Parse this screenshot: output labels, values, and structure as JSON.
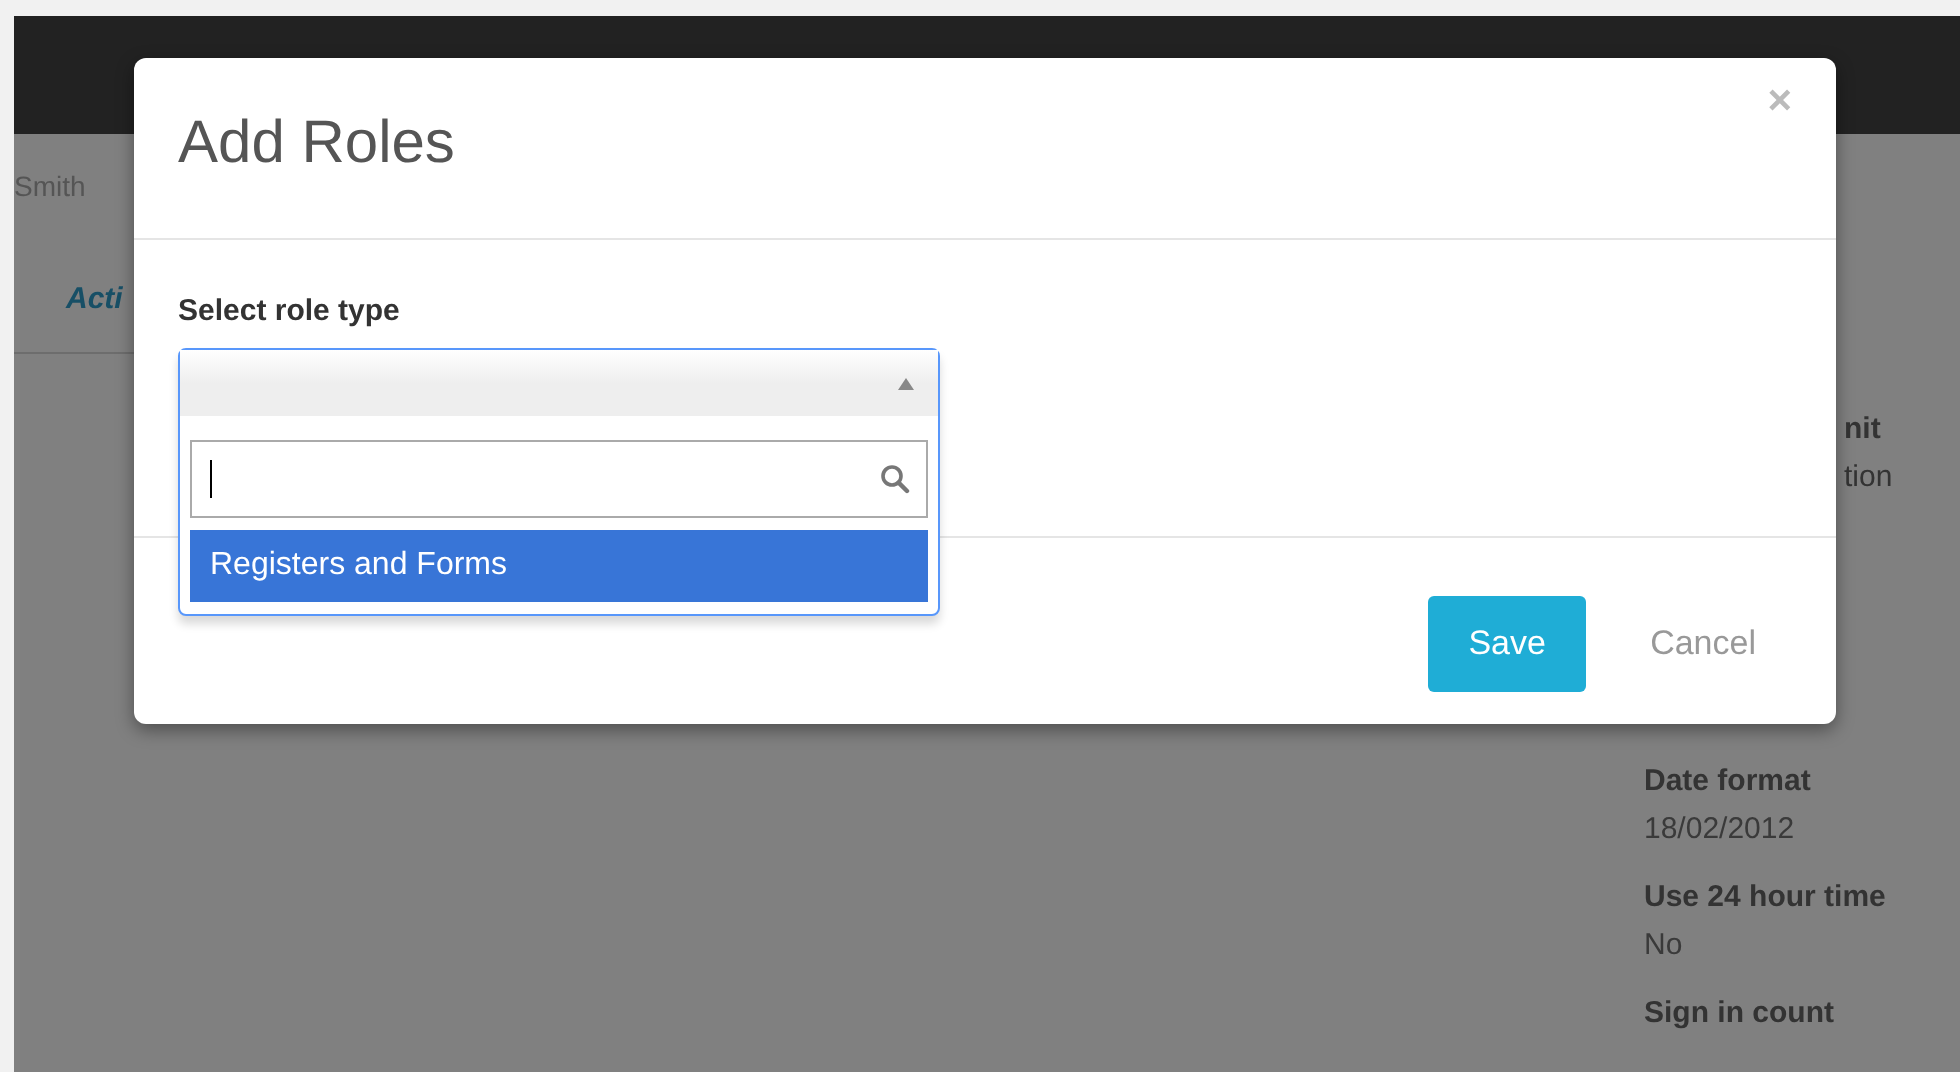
{
  "background_page": {
    "user_name": "Smith",
    "tab_label": "Acti",
    "cut_detail": {
      "label": "nit",
      "value": "tion"
    },
    "details": [
      {
        "label": "Date format",
        "value": "18/02/2012"
      },
      {
        "label": "Use 24 hour time",
        "value": "No"
      },
      {
        "label": "Sign in count"
      }
    ]
  },
  "dialog": {
    "title": "Add Roles",
    "close": "×",
    "field_label": "Select role type",
    "select": {
      "expanded": true,
      "options": [
        {
          "label": "Registers and Forms",
          "selected": true
        }
      ]
    },
    "buttons": [
      {
        "label": "Save",
        "kind": "primary"
      },
      {
        "label": "Cancel",
        "kind": "link"
      }
    ]
  }
}
